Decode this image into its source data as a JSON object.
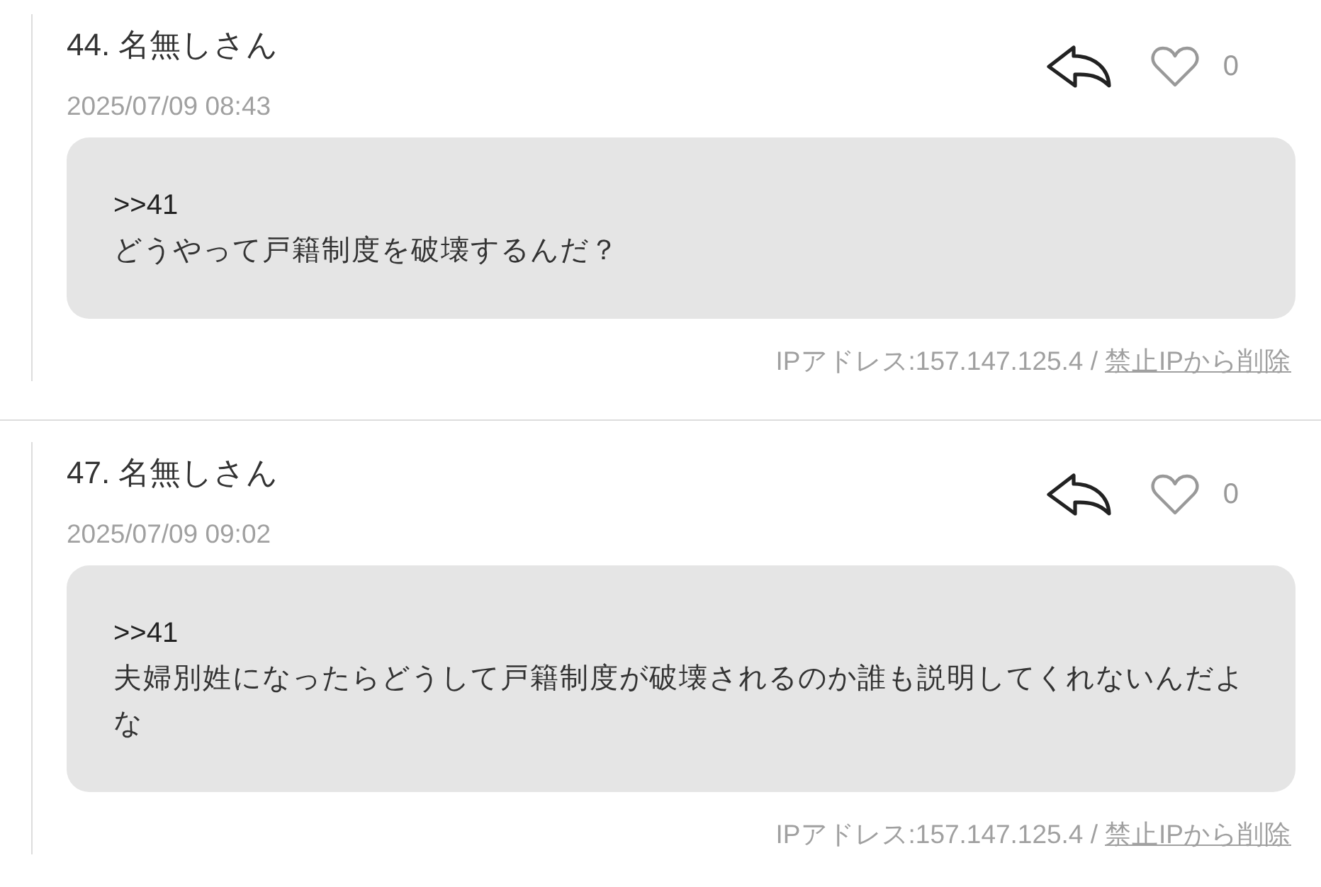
{
  "posts": [
    {
      "title": "44. 名無しさん",
      "date": "2025/07/09 08:43",
      "like_count": "0",
      "quote": ">>41",
      "body": "どうやって戸籍制度を破壊するんだ？",
      "ip_text": "IPアドレス:157.147.125.4 /",
      "delete_link": "禁止IPから削除"
    },
    {
      "title": "47. 名無しさん",
      "date": "2025/07/09 09:02",
      "like_count": "0",
      "quote": ">>41",
      "body": "夫婦別姓になったらどうして戸籍制度が破壊されるのか誰も説明してくれないんだよな",
      "ip_text": "IPアドレス:157.147.125.4 /",
      "delete_link": "禁止IPから削除"
    }
  ]
}
